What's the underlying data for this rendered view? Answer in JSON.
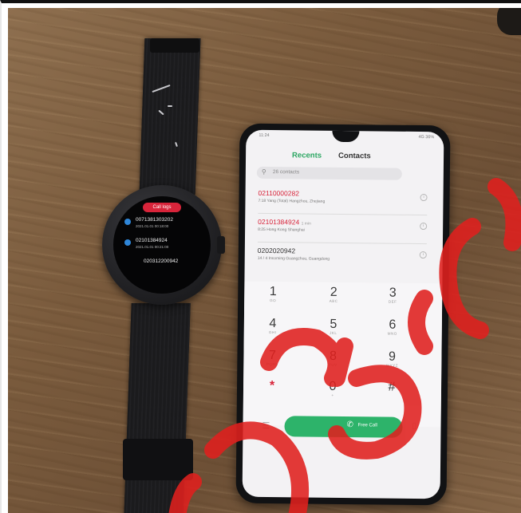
{
  "watch": {
    "header_label": "Call logs",
    "logs": [
      {
        "number": "0071381303202",
        "time": "2021.01.01 00:18:00"
      },
      {
        "number": "02101384924",
        "time": "2021.01.01 00:21:00"
      },
      {
        "number": "020312200942",
        "time": ""
      }
    ]
  },
  "phone": {
    "status_time": "11:24",
    "status_right": "4G 36%",
    "tabs": [
      "Recents",
      "Contacts"
    ],
    "search_placeholder": "26 contacts",
    "calls": [
      {
        "number": "02110000282",
        "detail": "7:18 Yang (Total) Hangzhou, Zhejiang",
        "color": "#d8243a"
      },
      {
        "number": "02101384924",
        "badge": "1 min",
        "detail": "8:25 Hong Kong Shanghai",
        "color": "#d8243a"
      },
      {
        "number": "0202020942",
        "detail": "14 / 4 Incoming Guangzhou, Guangdong",
        "color": "#333333"
      }
    ],
    "dialpad": [
      {
        "digit": "1",
        "letters": "GO"
      },
      {
        "digit": "2",
        "letters": "ABC"
      },
      {
        "digit": "3",
        "letters": "DEF"
      },
      {
        "digit": "4",
        "letters": "GHI"
      },
      {
        "digit": "5",
        "letters": "JKL"
      },
      {
        "digit": "6",
        "letters": "MNO"
      },
      {
        "digit": "7",
        "letters": "PQRS"
      },
      {
        "digit": "8",
        "letters": "TUV"
      },
      {
        "digit": "9",
        "letters": "WXYZ"
      },
      {
        "digit": "*",
        "letters": ""
      },
      {
        "digit": "0",
        "letters": "+"
      },
      {
        "digit": "#",
        "letters": ""
      }
    ],
    "call_button_label": "Free Call"
  },
  "colors": {
    "accent_green": "#2aa661",
    "missed_red": "#d8243a",
    "watermark_red": "#e0201e"
  }
}
